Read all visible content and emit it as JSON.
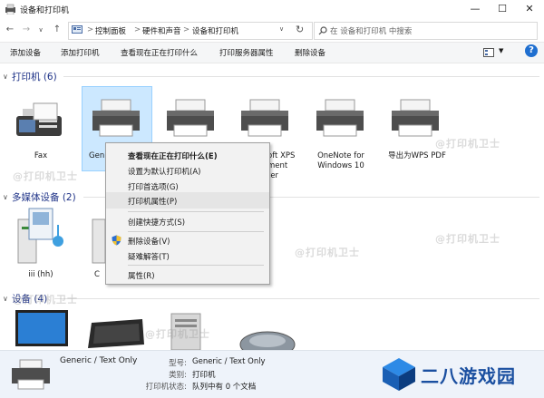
{
  "window": {
    "title": "设备和打印机",
    "minimize": "—",
    "maximize": "☐",
    "close": "✕"
  },
  "address": {
    "crumbs": [
      "控制面板",
      "硬件和声音",
      "设备和打印机"
    ],
    "separator": ">",
    "search_placeholder": "在 设备和打印机 中搜索"
  },
  "commands": [
    "添加设备",
    "添加打印机",
    "查看现在正在打印什么",
    "打印服务器属性",
    "删除设备"
  ],
  "groups": {
    "printers": {
      "label": "打印机 (6)",
      "items": [
        {
          "label": "Fax"
        },
        {
          "label": "Gen"
        },
        {
          "label": ""
        },
        {
          "label": "oft XPS",
          "label2": "ment",
          "label3": "ter"
        },
        {
          "label": "OneNote for",
          "label2": "Windows 10"
        },
        {
          "label": "导出为WPS PDF"
        }
      ]
    },
    "media": {
      "label": "多媒体设备 (2)",
      "items": [
        {
          "label": "iii (hh)"
        },
        {
          "label": "C"
        }
      ]
    },
    "devices": {
      "label": "设备 (4)"
    }
  },
  "context_menu": {
    "items": [
      {
        "label": "查看现在正在打印什么(E)",
        "bold": true
      },
      {
        "label": "设置为默认打印机(A)"
      },
      {
        "label": "打印首选项(G)"
      },
      {
        "label": "打印机属性(P)",
        "highlighted": true
      },
      {
        "label": "创建快捷方式(S)"
      },
      {
        "label": "删除设备(V)",
        "shield": true
      },
      {
        "label": "疑难解答(T)"
      },
      {
        "label": "属性(R)"
      }
    ]
  },
  "details": {
    "name": "Generic / Text Only",
    "model_label": "型号:",
    "model_value": "Generic / Text Only",
    "category_label": "类别:",
    "category_value": "打印机",
    "status_label": "打印机状态:",
    "status_value": "队列中有 0 个文档"
  },
  "watermark": "@打印机卫士",
  "brand": {
    "text": "二八游戏园",
    "color": "#1a4fa0"
  },
  "colors": {
    "group_header": "#1e3287",
    "selection": "#cce8ff",
    "accent": "#0078d7"
  }
}
